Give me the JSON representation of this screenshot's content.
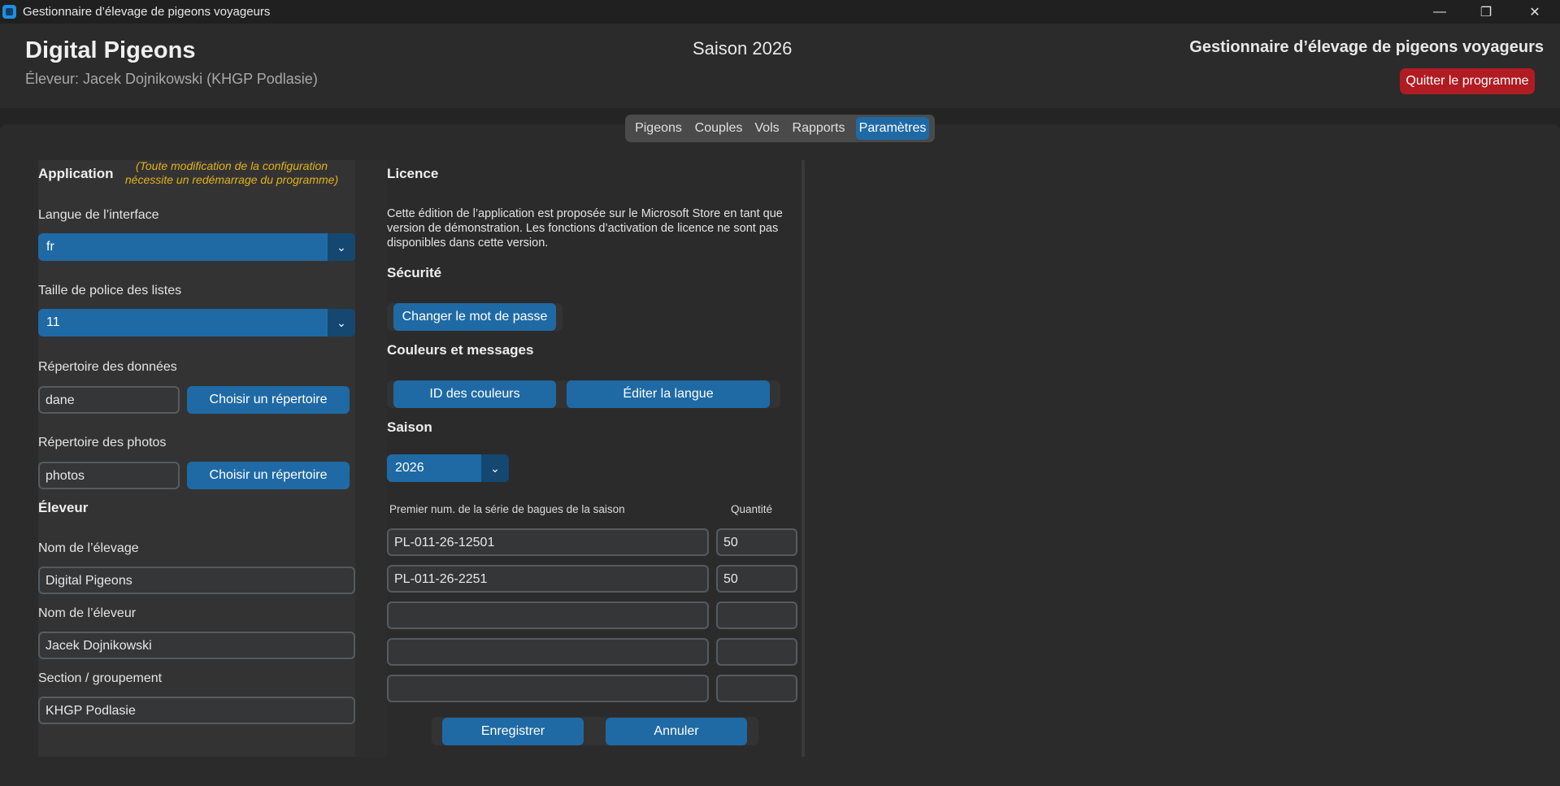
{
  "window": {
    "title": "Gestionnaire d’élevage de pigeons voyageurs",
    "minimize_icon": "minimize-icon",
    "maximize_icon": "restore-icon",
    "close_icon": "close-icon"
  },
  "header": {
    "brand": "Digital Pigeons",
    "breeder_line": "Éleveur: Jacek Dojnikowski (KHGP Podlasie)",
    "season": "Saison 2026",
    "subtitle": "Gestionnaire d’élevage de pigeons voyageurs",
    "quit_label": "Quitter le programme"
  },
  "tabs": [
    {
      "label": "Pigeons",
      "active": false
    },
    {
      "label": "Couples",
      "active": false
    },
    {
      "label": "Vols",
      "active": false
    },
    {
      "label": "Rapports",
      "active": false
    },
    {
      "label": "Paramètres",
      "active": true
    }
  ],
  "application": {
    "title": "Application",
    "note_line1": "(Toute modification de la configuration",
    "note_line2": "nécessite un redémarrage du programme)",
    "language_label": "Langue de l’interface",
    "language_value": "fr",
    "font_size_label": "Taille de police des listes",
    "font_size_value": "11",
    "data_dir_label": "Répertoire des données",
    "data_dir_value": "dane",
    "photo_dir_label": "Répertoire des photos",
    "photo_dir_value": "photos",
    "choose_dir_label": "Choisir un répertoire"
  },
  "breeder": {
    "title": "Éleveur",
    "loft_name_label": "Nom de l’élevage",
    "loft_name_value": "Digital Pigeons",
    "breeder_name_label": "Nom de l’éleveur",
    "breeder_name_value": "Jacek Dojnikowski",
    "section_label": "Section / groupement",
    "section_value": "KHGP Podlasie"
  },
  "license": {
    "title": "Licence",
    "line1": "Cette édition de l’application est proposée sur le Microsoft Store en tant que",
    "line2": "version de démonstration. Les fonctions d’activation de licence ne sont pas",
    "line3": "disponibles dans cette version."
  },
  "security": {
    "title": "Sécurité",
    "change_password_label": "Changer le mot de passe"
  },
  "colors": {
    "title": "Couleurs et messages",
    "color_ids_label": "ID des couleurs",
    "edit_language_label": "Éditer la langue"
  },
  "season": {
    "title": "Saison",
    "value": "2026",
    "col_series": "Premier num. de la série de bagues de la saison",
    "col_quantity": "Quantité",
    "rows": [
      {
        "series": "PL-011-26-12501",
        "qty": "50"
      },
      {
        "series": "PL-011-26-2251",
        "qty": "50"
      },
      {
        "series": "",
        "qty": ""
      },
      {
        "series": "",
        "qty": ""
      },
      {
        "series": "",
        "qty": ""
      }
    ],
    "save_label": "Enregistrer",
    "cancel_label": "Annuler"
  },
  "theme": {
    "accent": "#1f6aa5",
    "accent_dark": "#144870",
    "danger": "#b01c22",
    "note": "#e3b21a"
  }
}
